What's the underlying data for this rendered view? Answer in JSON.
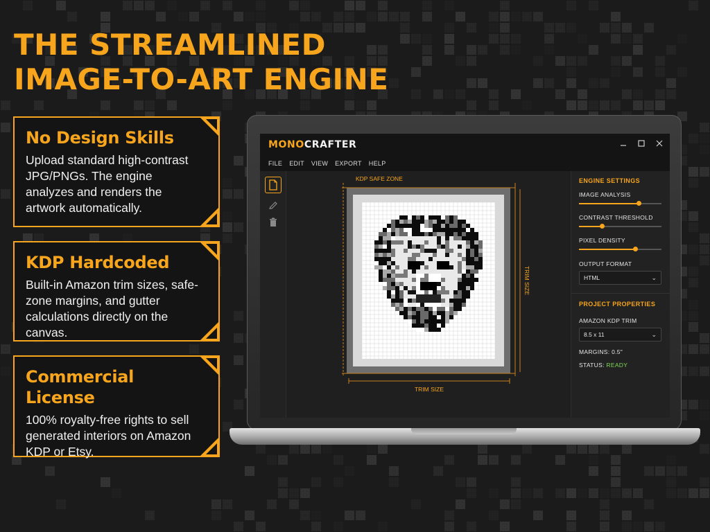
{
  "headline": {
    "line1": "THE STREAMLINED",
    "line2": "IMAGE-TO-ART ENGINE"
  },
  "features": [
    {
      "title": "No Design Skills",
      "body": "Upload standard high-contrast JPG/PNGs. The engine analyzes and renders the artwork automatically."
    },
    {
      "title": "KDP Hardcoded",
      "body": "Built-in Amazon trim sizes, safe-zone margins, and gutter calculations directly on the canvas."
    },
    {
      "title": "Commercial License",
      "body": "100% royalty-free rights to sell generated interiors on Amazon KDP or Etsy."
    }
  ],
  "app": {
    "logo_part1": "MONO",
    "logo_part2": "CRAFTER",
    "window_controls": [
      "minimize-icon",
      "maximize-icon",
      "close-icon"
    ],
    "menu": [
      "FILE",
      "EDIT",
      "VIEW",
      "EXPORT",
      "HELP"
    ],
    "tools": [
      "new-page-icon",
      "pencil-icon",
      "trash-icon"
    ],
    "canvas": {
      "safe_zone_label": "KDP SAFE ZONE",
      "trim_size_label": "TRIM SIZE",
      "trim_side_label": "TRIM SIZE"
    },
    "engine_settings": {
      "heading": "ENGINE SETTINGS",
      "image_analysis_label": "IMAGE ANALYSIS",
      "image_analysis_level": 0.72,
      "contrast_threshold_label": "CONTRAST THRESHOLD",
      "contrast_threshold_level": 0.28,
      "pixel_density_label": "PIXEL DENSITY",
      "pixel_density_level": 0.68,
      "output_format_label": "OUTPUT FORMAT",
      "output_format_value": "HTML"
    },
    "project_properties": {
      "heading": "PROJECT PROPERTIES",
      "trim_label": "AMAZON KDP TRIM",
      "trim_value": "8.5 x 11",
      "margins_text": "MARGINS: 0.5\"",
      "status_label": "STATUS:",
      "status_value": "READY"
    }
  },
  "colors": {
    "accent": "#f7a51c",
    "background": "#1b1b1b",
    "status_ready": "#7ed957"
  }
}
